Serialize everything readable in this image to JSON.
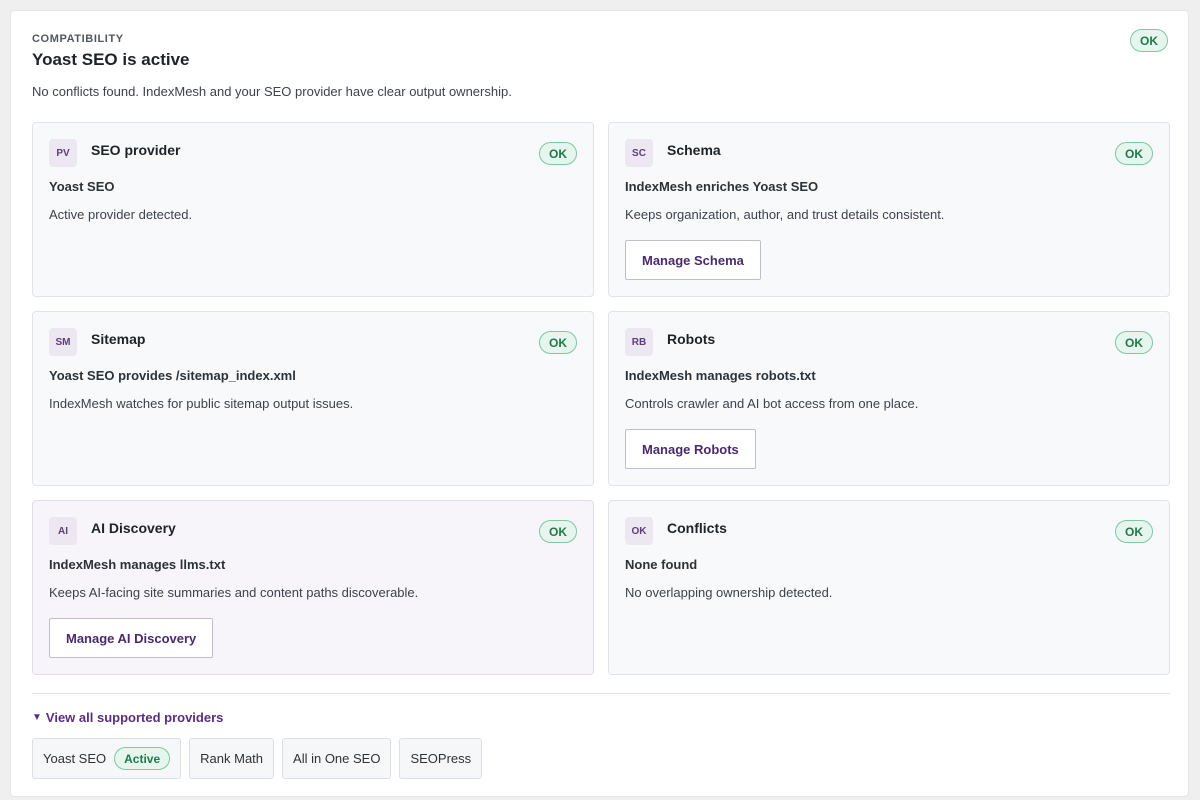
{
  "header": {
    "eyebrow": "COMPATIBILITY",
    "title": "Yoast SEO is active",
    "status": "OK",
    "summary": "No conflicts found. IndexMesh and your SEO provider have clear output ownership."
  },
  "cards": [
    {
      "abbr": "PV",
      "title": "SEO provider",
      "status": "OK",
      "subtitle": "Yoast SEO",
      "description": "Active provider detected."
    },
    {
      "abbr": "SC",
      "title": "Schema",
      "status": "OK",
      "subtitle": "IndexMesh enriches Yoast SEO",
      "description": "Keeps organization, author, and trust details consistent.",
      "button": "Manage Schema"
    },
    {
      "abbr": "SM",
      "title": "Sitemap",
      "status": "OK",
      "subtitle": "Yoast SEO provides /sitemap_index.xml",
      "description": "IndexMesh watches for public sitemap output issues."
    },
    {
      "abbr": "RB",
      "title": "Robots",
      "status": "OK",
      "subtitle": "IndexMesh manages robots.txt",
      "description": "Controls crawler and AI bot access from one place.",
      "button": "Manage Robots"
    },
    {
      "abbr": "AI",
      "title": "AI Discovery",
      "status": "OK",
      "subtitle": "IndexMesh manages llms.txt",
      "description": "Keeps AI-facing site summaries and content paths discoverable.",
      "button": "Manage AI Discovery"
    },
    {
      "abbr": "OK",
      "title": "Conflicts",
      "status": "OK",
      "subtitle": "None found",
      "description": "No overlapping ownership detected."
    }
  ],
  "providers_section": {
    "toggle_label": "View all supported providers",
    "caret_icon": "caret-down-icon",
    "items": [
      {
        "name": "Yoast SEO",
        "badge": "Active"
      },
      {
        "name": "Rank Math"
      },
      {
        "name": "All in One SEO"
      },
      {
        "name": "SEOPress"
      }
    ]
  },
  "colors": {
    "ok_bg": "#e6f6ee",
    "ok_border": "#7fc8a2",
    "ok_text": "#1e7a4c",
    "brand": "#5b2d7e"
  }
}
